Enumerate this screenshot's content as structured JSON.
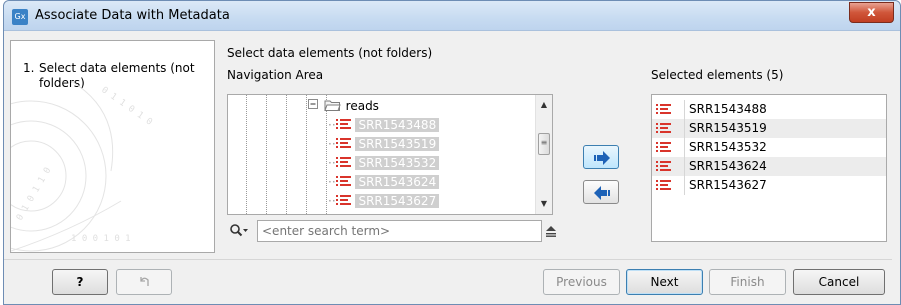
{
  "window": {
    "title": "Associate Data with Metadata",
    "app_icon_text": "Gx",
    "close_label": "x"
  },
  "steps": [
    {
      "number": "1.",
      "label": "Select data elements (not folders)"
    }
  ],
  "main": {
    "section_title": "Select data elements (not folders)",
    "navigation_label": "Navigation Area",
    "selected_label": "Selected elements (5)"
  },
  "tree": {
    "folder": "reads",
    "items": [
      "SRR1543488",
      "SRR1543519",
      "SRR1543532",
      "SRR1543624",
      "SRR1543627"
    ]
  },
  "search": {
    "placeholder": "<enter search term>"
  },
  "selected": {
    "items": [
      "SRR1543488",
      "SRR1543519",
      "SRR1543532",
      "SRR1543624",
      "SRR1543627"
    ]
  },
  "footer": {
    "help_label": "?",
    "previous_label": "Previous",
    "next_label": "Next",
    "finish_label": "Finish",
    "cancel_label": "Cancel"
  },
  "colors": {
    "accent": "#3b82c6",
    "sequence_icon": "#d9342b"
  }
}
